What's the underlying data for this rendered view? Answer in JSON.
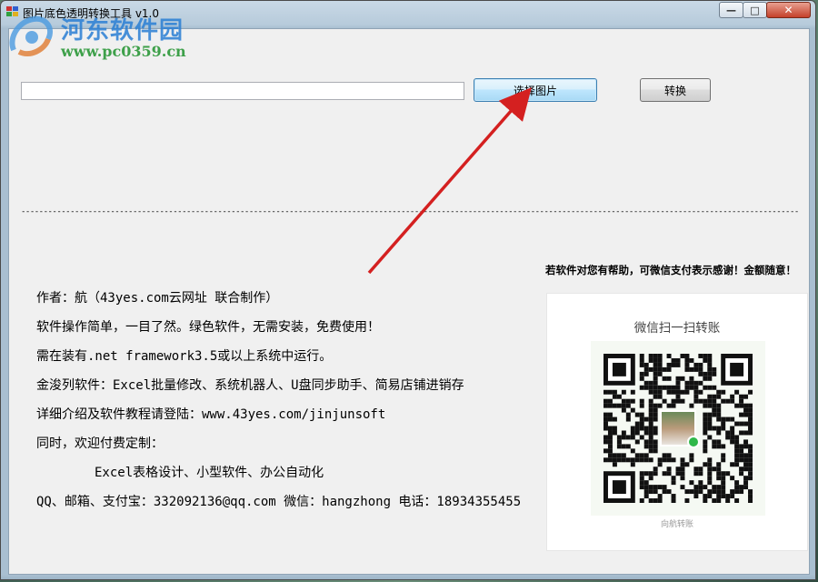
{
  "window": {
    "title": "图片底色透明转换工具 v1.0",
    "controls": {
      "minimize": "—",
      "maximize": "□",
      "close": "✕"
    }
  },
  "watermark": {
    "brand": "河东软件园",
    "url": "www.pc0359.cn"
  },
  "toolbar": {
    "path_value": "",
    "choose_label": "选择图片",
    "convert_label": "转换"
  },
  "separator_text": "------------------------------------------------------------------------------------------------------------------------------------------------------------------------------",
  "info_lines": [
    "作者：航（43yes.com云网址 联合制作）",
    "软件操作简单，一目了然。绿色软件，无需安装，免费使用！",
    "需在装有.net framework3.5或以上系统中运行。",
    "金浚列软件：Excel批量修改、系统机器人、U盘同步助手、简易店铺进销存",
    "详细介绍及软件教程请登陆：www.43yes.com/jinjunsoft",
    "同时，欢迎付费定制：",
    "Excel表格设计、小型软件、办公自动化",
    "QQ、邮箱、支付宝：332092136@qq.com  微信：hangzhong 电话：18934355455"
  ],
  "donate": {
    "note": "若软件对您有帮助，可微信支付表示感谢！金额随意！",
    "qr_title": "微信扫一扫转账",
    "qr_name": "向航转账"
  },
  "colors": {
    "arrow": "#d42020",
    "brand_blue": "#2a7fd4",
    "brand_green": "#3ea04a",
    "wechat_green": "#2fb84a"
  }
}
